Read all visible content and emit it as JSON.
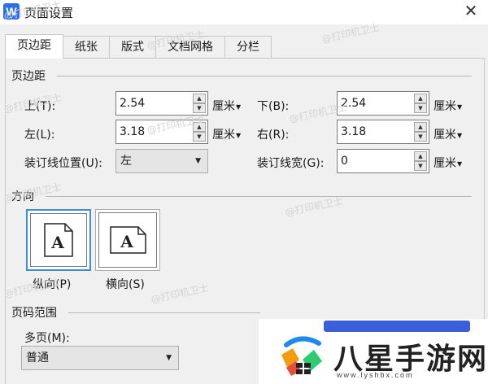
{
  "window": {
    "title": "页面设置",
    "app_icon_letter": "W"
  },
  "tabs": [
    {
      "label": "页边距",
      "active": true
    },
    {
      "label": "纸张"
    },
    {
      "label": "版式"
    },
    {
      "label": "文档网格"
    },
    {
      "label": "分栏"
    }
  ],
  "margins": {
    "section_title": "页边距",
    "top": {
      "label": "上(T):",
      "value": "2.54",
      "unit": "厘米"
    },
    "bottom": {
      "label": "下(B):",
      "value": "2.54",
      "unit": "厘米"
    },
    "left": {
      "label": "左(L):",
      "value": "3.18",
      "unit": "厘米"
    },
    "right": {
      "label": "右(R):",
      "value": "3.18",
      "unit": "厘米"
    },
    "gutter_position": {
      "label": "装订线位置(U):",
      "value": "左"
    },
    "gutter_width": {
      "label": "装订线宽(G):",
      "value": "0",
      "unit": "厘米"
    }
  },
  "orientation": {
    "section_title": "方向",
    "portrait": {
      "label": "纵向(P)",
      "glyph": "A",
      "selected": true
    },
    "landscape": {
      "label": "横向(S)",
      "glyph": "A"
    }
  },
  "pages": {
    "section_title": "页码范围",
    "multiple_label": "多页(M):",
    "multiple_value": "普通"
  },
  "watermark_text": "@打印机卫士",
  "badge": {
    "name": "八星手游网",
    "url": "www.lyshbx.com"
  }
}
